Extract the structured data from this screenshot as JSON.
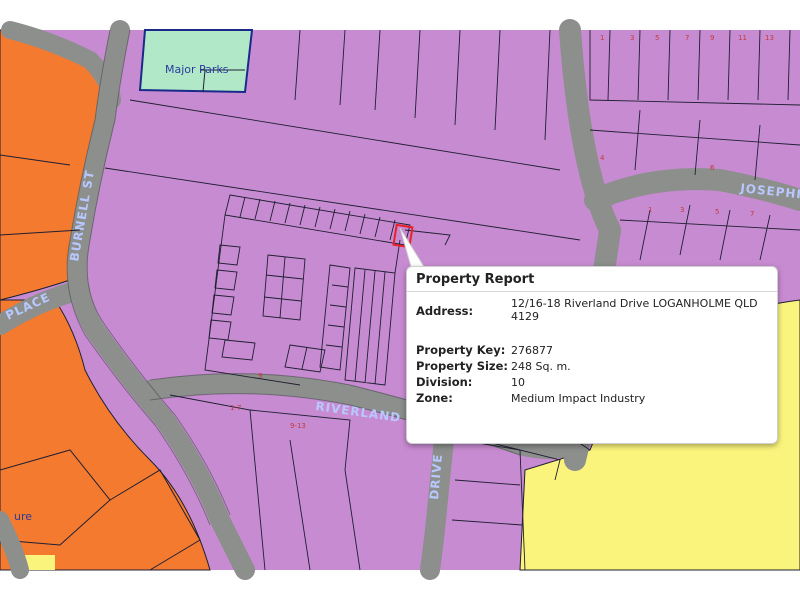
{
  "colors": {
    "industry": "#c78bd1",
    "road": "#8c8f8c",
    "orange": "#f47a30",
    "parks": "#b0e8c8",
    "yellow": "#fbf47c",
    "outline": "#1f1f33",
    "selected": "#e8202a"
  },
  "map_labels": {
    "major_parks": "Major Parks",
    "burnell_st": "BURNELL ST",
    "place": "PLACE",
    "riverland": "RIVERLAND",
    "josephine": "JOSEPHI",
    "drive": "DRIVE",
    "ure": "ure"
  },
  "popup": {
    "title": "Property Report",
    "address_label": "Address:",
    "address_line1": "12/16-18 Riverland Drive LOGANHOLME QLD",
    "address_line2": "4129",
    "property_key_label": "Property Key:",
    "property_key": "276877",
    "property_size_label": "Property Size:",
    "property_size": "248 Sq. m.",
    "division_label": "Division:",
    "division": "10",
    "zone_label": "Zone:",
    "zone": "Medium Impact Industry"
  }
}
